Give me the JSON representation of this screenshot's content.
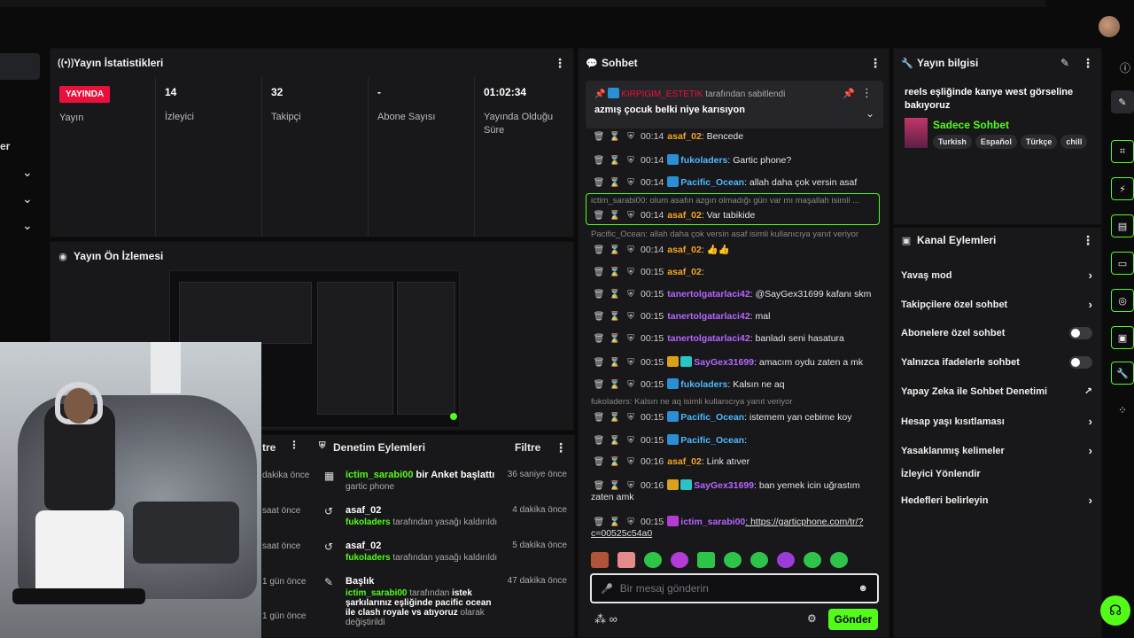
{
  "colors": {
    "accent": "#53fc18",
    "live": "#e9113c",
    "bg": "#0b0b0c",
    "panel": "#18181a"
  },
  "left_nav": {
    "partial_text": "er"
  },
  "stats": {
    "title": "Yayın İstatistikleri",
    "live_badge": "YAYINDA",
    "live_label": "Yayın",
    "viewers_value": "14",
    "viewers_label": "İzleyici",
    "followers_value": "32",
    "followers_label": "Takipçi",
    "subs_value": "-",
    "subs_label": "Abone Sayısı",
    "uptime_value": "01:02:34",
    "uptime_label": "Yayında Olduğu Süre"
  },
  "preview": {
    "title": "Yayın Ön İzlemesi"
  },
  "mod_actions": {
    "title_partial": "tre",
    "title": "Denetim Eylemleri",
    "filter": "Filtre",
    "left_times": [
      "dakika önce",
      "saat önce",
      "saat önce",
      "1 gün önce",
      "1 gün önce"
    ],
    "items": [
      {
        "title_user": "ictim_sarabi00",
        "title_rest": " bir Anket başlattı",
        "sub": "gartic phone",
        "time": "36 saniye önce"
      },
      {
        "title_user": "",
        "title_rest": "asaf_02",
        "sub_user": "fukoladers",
        "sub": " tarafından yasağı kaldırıldı",
        "time": "4 dakika önce"
      },
      {
        "title_user": "",
        "title_rest": "asaf_02",
        "sub_user": "fukoladers",
        "sub": " tarafından yasağı kaldırıldı",
        "time": "5 dakika önce"
      },
      {
        "title_user": "",
        "title_rest": "Başlık",
        "time": "47 dakika önce",
        "sub_user": "ictim_sarabi00",
        "sub_mid": " tarafından ",
        "sub_bold": "istek şarkılarınız eşliğinde pacific ocean ile clash royale vs atıyoruz",
        "sub_end": " olarak değiştirildi"
      }
    ]
  },
  "chat": {
    "title": "Sohbet",
    "pinned_user": "KIRPIGIM_ESTETIK",
    "pinned_by": " tarafından sabitlendi",
    "pinned_msg": "azmış çocuk belki niye karısıyon",
    "reply1": "ictim_sarabi00: olum asafın azgın olmadığı gün var mı maşallah isimli ...",
    "reply2": "Pacific_Ocean: allah daha çok versin asaf isimli kullanıcıya yanıt veriyor",
    "reply3": "fukoladers: Kalsın ne aq isimli kullanıcıya yanıt veriyor",
    "messages": [
      {
        "time": "00:14",
        "user": "asaf_02",
        "msg": ": Bencede"
      },
      {
        "time": "00:14",
        "user": "fukoladers",
        "msg": ": Gartic phone?"
      },
      {
        "time": "00:14",
        "user": "Pacific_Ocean",
        "msg": ": allah daha çok versin asaf"
      },
      {
        "time": "00:14",
        "user": "asaf_02",
        "msg": ": Var tabikide"
      },
      {
        "time": "00:14",
        "user": "asaf_02",
        "msg": ": 👍👍"
      },
      {
        "time": "00:15",
        "user": "asaf_02",
        "msg": ":"
      },
      {
        "time": "00:15",
        "user": "tanertolgatarlaci42",
        "msg": ": @SayGex31699 kafanı skm"
      },
      {
        "time": "00:15",
        "user": "tanertolgatarlaci42",
        "msg": ": mal"
      },
      {
        "time": "00:15",
        "user": "tanertolgatarlaci42",
        "msg": ": banladı seni hasatura"
      },
      {
        "time": "00:15",
        "user": "SayGex31699",
        "msg": ": amacım oydu zaten a mk"
      },
      {
        "time": "00:15",
        "user": "fukoladers",
        "msg": ": Kalsın ne aq"
      },
      {
        "time": "00:15",
        "user": "Pacific_Ocean",
        "msg": ": istemem yan cebime koy"
      },
      {
        "time": "00:15",
        "user": "Pacific_Ocean",
        "msg": ":"
      },
      {
        "time": "00:16",
        "user": "asaf_02",
        "msg": ": Link atıver"
      },
      {
        "time": "00:16",
        "user": "SayGex31699",
        "msg": ": ban yemek icin uğrastım"
      },
      {
        "time": "00:15",
        "user": "ictim_sarabi00",
        "msg": ": https://garticphone.com/tr/?"
      }
    ],
    "wrap1": "zaten amk",
    "wrap2": "c=00525c54a0",
    "placeholder": "Bir mesaj gönderin",
    "send": "Gönder"
  },
  "stream_info": {
    "title": "Yayın bilgisi",
    "stream_title": "reels eşliğinde kanye west görseline bakıyoruz",
    "category": "Sadece Sohbet",
    "tags": [
      "Turkish",
      "Español",
      "Türkçe",
      "chill"
    ]
  },
  "channel_actions": {
    "title": "Kanal Eylemleri",
    "items": [
      "Yavaş mod",
      "Takipçilere özel sohbet",
      "Abonelere özel sohbet",
      "Yalnızca ifadelerle sohbet",
      "Yapay Zeka ile Sohbet Denetimi",
      "Hesap yaşı kısıtlaması",
      "Yasaklanmış kelimeler",
      "İzleyici Yönlendir",
      "Hedefleri belirleyin"
    ]
  }
}
